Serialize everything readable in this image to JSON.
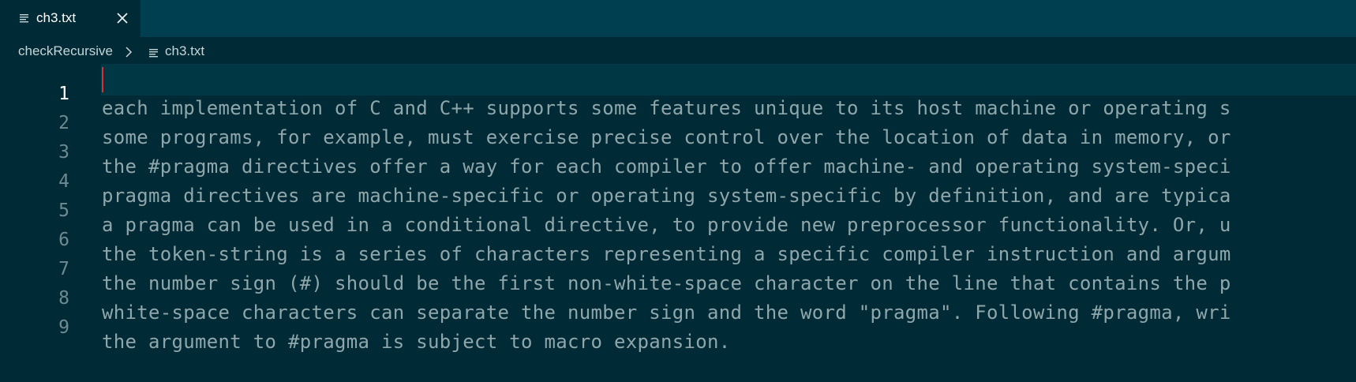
{
  "tabs": [
    {
      "label": "ch3.txt",
      "icon": "text-file-icon",
      "close_icon": "close-icon",
      "active": true
    }
  ],
  "breadcrumb": {
    "folder": "checkRecursive",
    "separator_icon": "chevron-right-icon",
    "file_icon": "text-file-icon",
    "file": "ch3.txt"
  },
  "editor": {
    "active_line": 1,
    "lines": [
      {
        "number": "1",
        "text": "each implementation of C and C++ supports some features unique to its host machine or operating s"
      },
      {
        "number": "2",
        "text": "some programs, for example, must exercise precise control over the location of data in memory, or"
      },
      {
        "number": "3",
        "text": "the #pragma directives offer a way for each compiler to offer machine- and operating system-speci"
      },
      {
        "number": "4",
        "text": "pragma directives are machine-specific or operating system-specific by definition, and are typica"
      },
      {
        "number": "5",
        "text": "a pragma can be used in a conditional directive, to provide new preprocessor functionality. Or, u"
      },
      {
        "number": "6",
        "text": "the token-string is a series of characters representing a specific compiler instruction and argum"
      },
      {
        "number": "7",
        "text": "the number sign (#) should be the first non-white-space character on the line that contains the p"
      },
      {
        "number": "8",
        "text": "white-space characters can separate the number sign and the word \"pragma\". Following #pragma, wri"
      },
      {
        "number": "9",
        "text": "the argument to #pragma is subject to macro expansion."
      }
    ]
  },
  "colors": {
    "background": "#002b36",
    "tabbar": "#003f4f",
    "text": "#8fa6ab",
    "line_number": "#6e8a92",
    "cursor": "#dc322f"
  }
}
